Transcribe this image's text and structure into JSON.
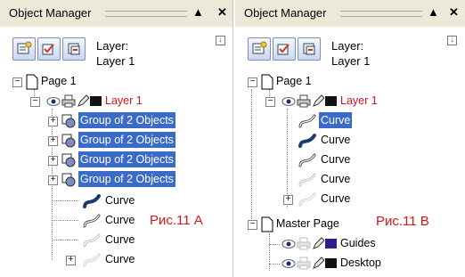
{
  "left": {
    "title": "Object Manager",
    "layer_caption": "Layer:",
    "layer_name": "Layer 1",
    "page": "Page 1",
    "layer": "Layer 1",
    "groups": [
      "Group of 2 Objects",
      "Group of 2 Objects",
      "Group of 2 Objects",
      "Group of 2 Objects"
    ],
    "curves": [
      "Curve",
      "Curve",
      "Curve",
      "Curve"
    ],
    "figure_label": "Рис.11 А"
  },
  "right": {
    "title": "Object Manager",
    "layer_caption": "Layer:",
    "layer_name": "Layer 1",
    "page": "Page 1",
    "layer": "Layer 1",
    "curves": [
      "Curve",
      "Curve",
      "Curve",
      "Curve",
      "Curve"
    ],
    "master_page": "Master Page",
    "guides": "Guides",
    "desktop": "Desktop",
    "figure_label": "Рис.11 В"
  },
  "colors": {
    "selection": "#3a6bc8",
    "red_label": "#d8141a",
    "guides_swatch": "#2b1f8c",
    "layer_swatch": "#111111"
  },
  "icons": {
    "title_pin": "triangle-up-icon",
    "title_close": "close-icon",
    "tools": [
      "new-layer-icon",
      "edit-across-layers-icon",
      "layer-manager-view-icon"
    ],
    "options": "options-arrow-icon",
    "page": "page-icon",
    "visibility": "eye-icon",
    "print": "printer-icon",
    "edit": "pencil-icon",
    "group": "group-icon",
    "curve": "curve-icon"
  }
}
